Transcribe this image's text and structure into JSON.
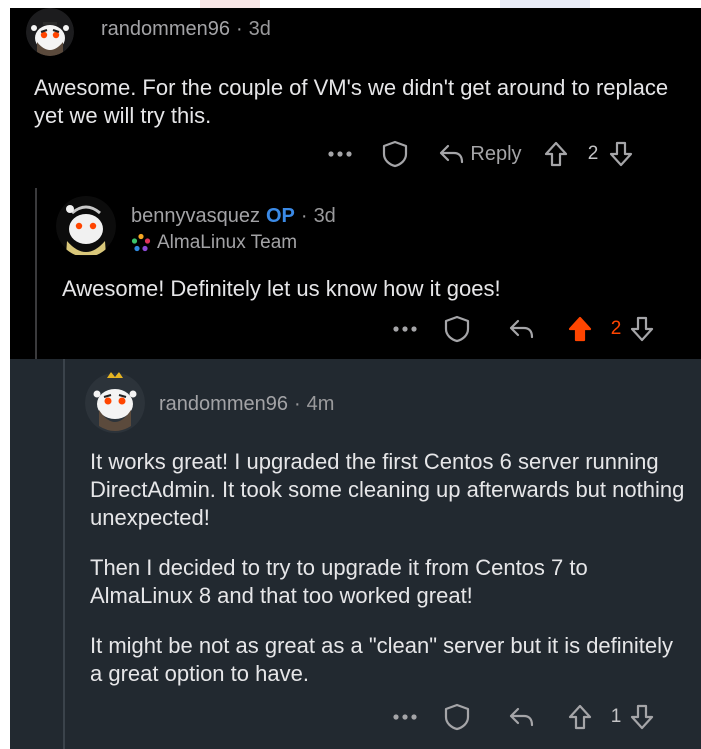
{
  "comments": [
    {
      "username": "randommen96",
      "time": "3d",
      "body": [
        "Awesome. For the couple of VM's we didn't get around to replace yet we will try this."
      ],
      "actions": {
        "more": "•••",
        "reply_label": "Reply",
        "score": "2"
      }
    },
    {
      "username": "bennyvasquez",
      "op_badge": "OP",
      "time": "3d",
      "flair": "AlmaLinux Team",
      "body": [
        "Awesome! Definitely let us know how it goes!"
      ],
      "actions": {
        "more": "•••",
        "score": "2",
        "upvoted": true
      }
    },
    {
      "username": "randommen96",
      "time": "4m",
      "body": [
        "It works great! I upgraded the first Centos 6 server running DirectAdmin. It took some cleaning up afterwards but nothing unexpected!",
        "Then I decided to try to upgrade it from Centos 7 to AlmaLinux 8 and that too worked great!",
        "It might be not as great as a \"clean\" server but it is definitely a great option to have."
      ],
      "actions": {
        "more": "•••",
        "score": "1"
      }
    }
  ],
  "colors": {
    "background_top": "#000000",
    "background_reply": "#222930",
    "op_blue": "#3b8ae6",
    "upvote_orange": "#ff4500"
  },
  "icons": [
    "avatar",
    "more-icon",
    "award-shield-icon",
    "reply-icon",
    "upvote-icon",
    "downvote-icon",
    "almalinux-logo-icon"
  ]
}
